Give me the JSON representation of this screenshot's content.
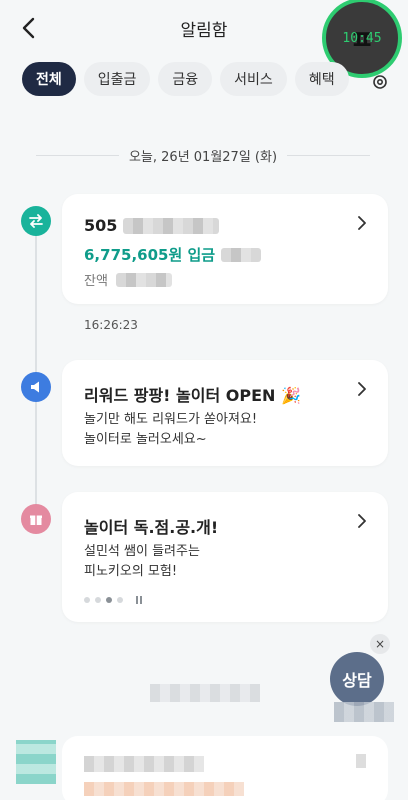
{
  "header": {
    "title": "알림함",
    "clock_glyph": "ㅍ",
    "clock_time": "10:45"
  },
  "filters": {
    "items": [
      {
        "label": "전체",
        "active": true
      },
      {
        "label": "입출금",
        "active": false
      },
      {
        "label": "금융",
        "active": false
      },
      {
        "label": "서비스",
        "active": false
      },
      {
        "label": "혜택",
        "active": false
      }
    ]
  },
  "date_separator": "오늘, 26년 01월27일 (화)",
  "notifications": [
    {
      "type": "transfer",
      "icon": "transfer-arrows-icon",
      "account_prefix": "505",
      "amount_text": "6,775,605원 입금",
      "balance_label": "잔액",
      "time": "16:26:23"
    },
    {
      "type": "event",
      "icon": "megaphone-icon",
      "title": "리워드 팡팡! 놀이터 OPEN 🎉",
      "body_line1": "놀기만 해도 리워드가 쏟아져요!",
      "body_line2": "놀이터로 놀러오세요~"
    },
    {
      "type": "promo",
      "icon": "gift-icon",
      "title": "놀이터 독.점.공.개!",
      "body_line1": "설민석 쌤이 들려주는",
      "body_line2": "피노키오의 모험!",
      "carousel": {
        "count": 4,
        "active_index": 2
      }
    }
  ],
  "counsel_button": {
    "label": "상담",
    "close": "×"
  },
  "colors": {
    "active_chip": "#1f2a44",
    "deposit_amount": "#0f9c8a",
    "transfer_icon_bg": "#19b39b",
    "speaker_icon_bg": "#3d7ce0",
    "gift_icon_bg": "#e48aa0"
  }
}
